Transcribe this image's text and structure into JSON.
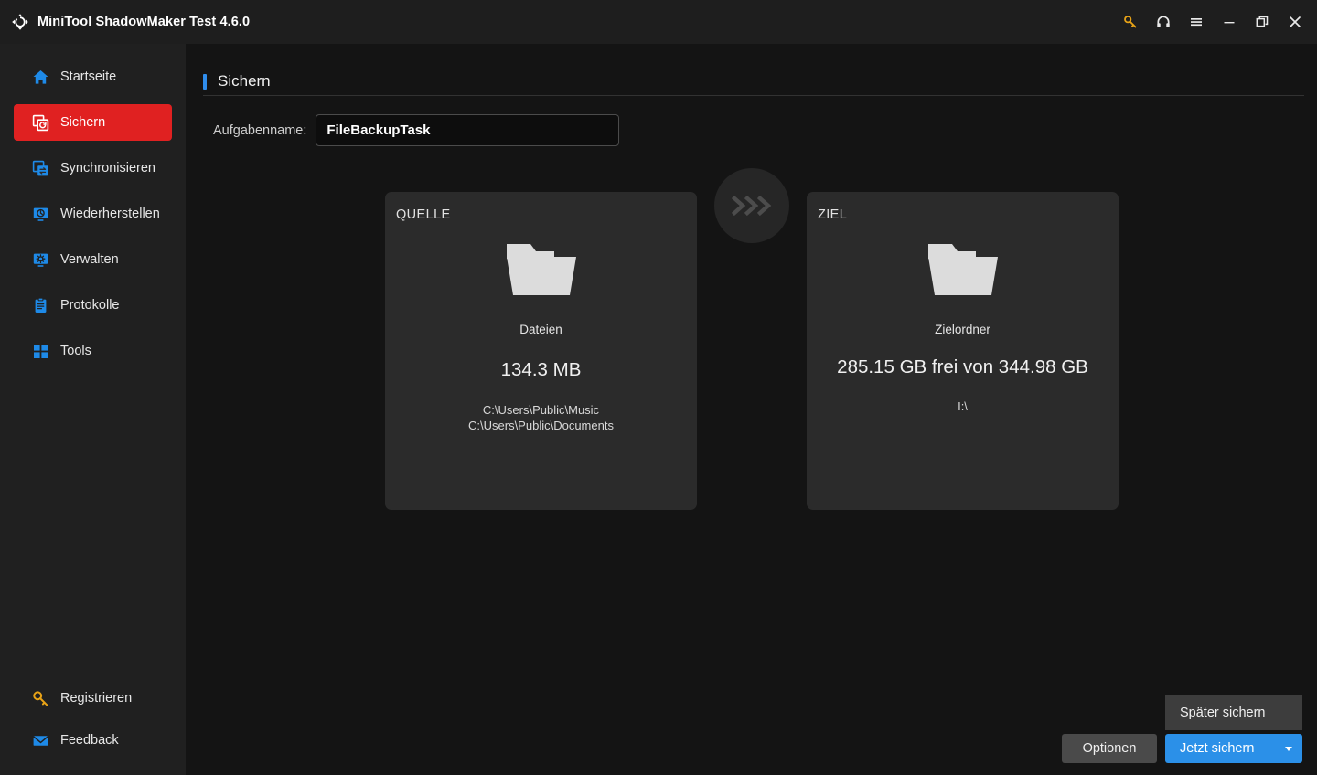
{
  "window": {
    "title": "MiniTool ShadowMaker Test 4.6.0",
    "logo_icon": "shadowmaker-logo-icon",
    "controls": [
      {
        "name": "key-icon",
        "label": "Registrieren"
      },
      {
        "name": "headset-icon",
        "label": "Support"
      },
      {
        "name": "hamburger-icon",
        "label": "Menu"
      },
      {
        "name": "minimize-icon",
        "label": "Minimieren"
      },
      {
        "name": "restore-icon",
        "label": "Wiederherstellen"
      },
      {
        "name": "close-icon",
        "label": "Schliessen"
      }
    ]
  },
  "sidebar": {
    "items": [
      {
        "icon": "home-icon",
        "label": "Startseite",
        "active": false
      },
      {
        "icon": "backup-icon",
        "label": "Sichern",
        "active": true
      },
      {
        "icon": "sync-icon",
        "label": "Synchronisieren",
        "active": false
      },
      {
        "icon": "restore-icon",
        "label": "Wiederherstellen",
        "active": false
      },
      {
        "icon": "manage-icon",
        "label": "Verwalten",
        "active": false
      },
      {
        "icon": "logs-icon",
        "label": "Protokolle",
        "active": false
      },
      {
        "icon": "tools-icon",
        "label": "Tools",
        "active": false
      }
    ],
    "bottom_items": [
      {
        "icon": "key-icon",
        "label": "Registrieren"
      },
      {
        "icon": "envelope-icon",
        "label": "Feedback"
      }
    ]
  },
  "main": {
    "section_title": "Sichern",
    "task": {
      "label": "Aufgabenname:",
      "value": "FileBackupTask",
      "placeholder": "Aufgabenname"
    },
    "source": {
      "kicker": "QUELLE",
      "icon": "folder-icon",
      "type": "Dateien",
      "size": "134.3 MB",
      "paths": "C:\\Users\\Public\\Music\nC:\\Users\\Public\\Documents"
    },
    "transfer_icon": "triple-chevron-right-icon",
    "destination": {
      "kicker": "ZIEL",
      "icon": "folder-icon",
      "type": "Zielordner",
      "capacity": "285.15 GB frei von 344.98 GB",
      "path": "I:\\"
    }
  },
  "footer": {
    "options_label": "Optionen",
    "backup_now_label": "Jetzt sichern",
    "backup_later_label": "Später sichern",
    "caret_icon": "chevron-down-icon"
  },
  "colors": {
    "accent_blue": "#2b90e8",
    "active_red": "#e02121",
    "icon_blue": "#1e8ae8",
    "key_yellow": "#e8a317",
    "panel_bg": "#2b2b2b",
    "sidebar_bg": "#202020",
    "content_bg": "#141414",
    "titlebar_bg": "#1e1e1e"
  }
}
